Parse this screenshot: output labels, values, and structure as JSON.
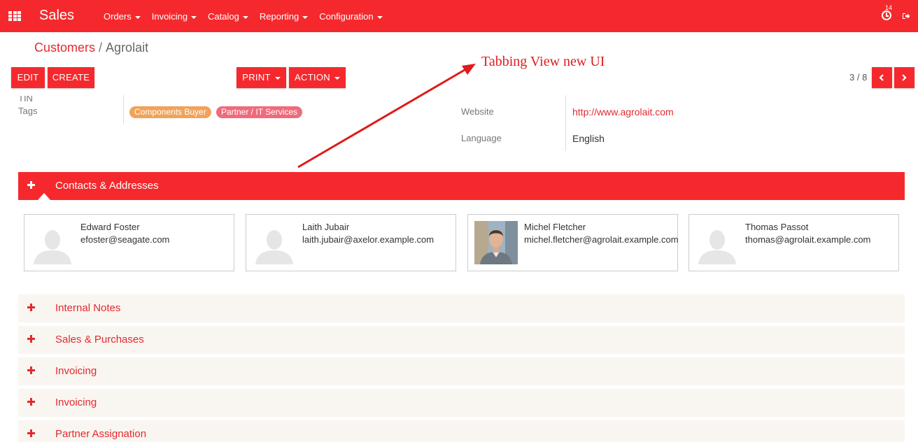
{
  "navbar": {
    "app_name": "Sales",
    "menu": [
      {
        "label": "Orders"
      },
      {
        "label": "Invoicing"
      },
      {
        "label": "Catalog"
      },
      {
        "label": "Reporting"
      },
      {
        "label": "Configuration"
      }
    ],
    "activity_count": "14",
    "icons": [
      "apps-grid-icon",
      "clock-icon",
      "logout-icon"
    ]
  },
  "breadcrumb": {
    "parent": "Customers",
    "separator": "/",
    "current": "Agrolait"
  },
  "toolbar": {
    "edit_label": "EDIT",
    "create_label": "CREATE",
    "print_label": "PRINT",
    "action_label": "ACTION",
    "pager": "3 / 8"
  },
  "annotation": {
    "text": "Tabbing View new UI"
  },
  "form": {
    "tin_label": "TIN",
    "tags_label": "Tags",
    "tags": [
      {
        "label": "Components Buyer",
        "color": "#f0a35b"
      },
      {
        "label": "Partner / IT Services",
        "color": "#ef6b7b"
      }
    ],
    "website_label": "Website",
    "website_value": "http://www.agrolait.com",
    "language_label": "Language",
    "language_value": "English"
  },
  "contacts_section": {
    "title": "Contacts & Addresses",
    "contacts": [
      {
        "name": "Edward Foster",
        "email": "efoster@seagate.com",
        "avatar": "placeholder"
      },
      {
        "name": "Laith Jubair",
        "email": "laith.jubair@axelor.example.com",
        "avatar": "placeholder"
      },
      {
        "name": "Michel Fletcher",
        "email": "michel.fletcher@agrolait.example.com",
        "avatar": "photo"
      },
      {
        "name": "Thomas Passot",
        "email": "thomas@agrolait.example.com",
        "avatar": "placeholder"
      }
    ]
  },
  "sections": [
    {
      "title": "Internal Notes"
    },
    {
      "title": "Sales & Purchases"
    },
    {
      "title": "Invoicing"
    },
    {
      "title": "Invoicing"
    },
    {
      "title": "Partner Assignation"
    }
  ],
  "colors": {
    "primary": "#f5292d",
    "link": "#e32a2f",
    "section_bg": "#f9f5f1"
  }
}
